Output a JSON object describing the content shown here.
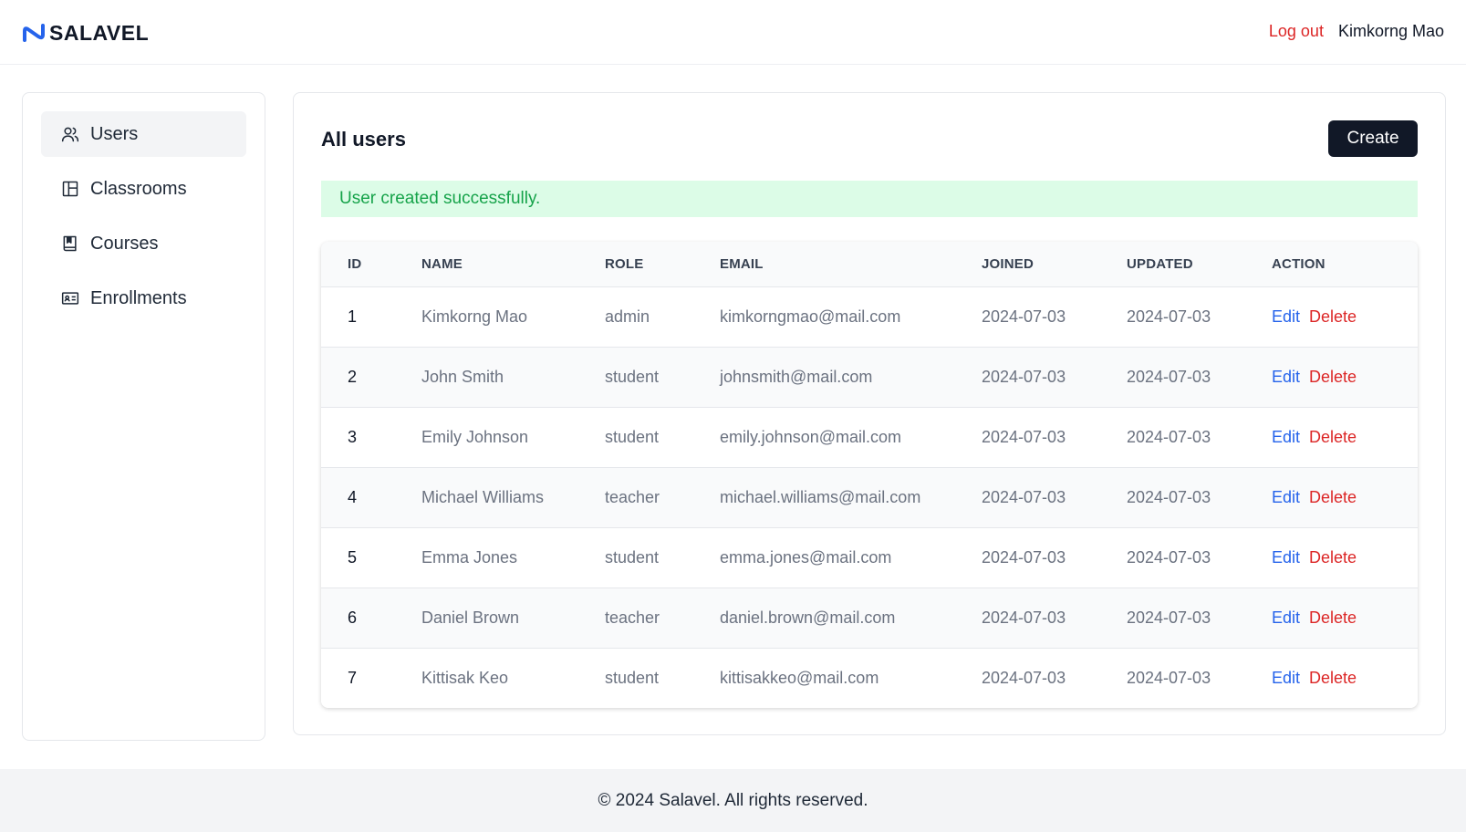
{
  "header": {
    "brand": "SALAVEL",
    "logout_label": "Log out",
    "user_name": "Kimkorng Mao"
  },
  "sidebar": {
    "items": [
      {
        "label": "Users",
        "icon": "users-icon",
        "active": true
      },
      {
        "label": "Classrooms",
        "icon": "layout-icon",
        "active": false
      },
      {
        "label": "Courses",
        "icon": "book-icon",
        "active": false
      },
      {
        "label": "Enrollments",
        "icon": "id-card-icon",
        "active": false
      }
    ]
  },
  "main": {
    "title": "All users",
    "create_label": "Create",
    "alert": "User created successfully."
  },
  "table": {
    "headers": [
      "ID",
      "NAME",
      "ROLE",
      "EMAIL",
      "JOINED",
      "UPDATED",
      "ACTION"
    ],
    "edit_label": "Edit",
    "delete_label": "Delete",
    "rows": [
      {
        "id": "1",
        "name": "Kimkorng Mao",
        "role": "admin",
        "email": "kimkorngmao@mail.com",
        "joined": "2024-07-03",
        "updated": "2024-07-03"
      },
      {
        "id": "2",
        "name": "John Smith",
        "role": "student",
        "email": "johnsmith@mail.com",
        "joined": "2024-07-03",
        "updated": "2024-07-03"
      },
      {
        "id": "3",
        "name": "Emily Johnson",
        "role": "student",
        "email": "emily.johnson@mail.com",
        "joined": "2024-07-03",
        "updated": "2024-07-03"
      },
      {
        "id": "4",
        "name": "Michael Williams",
        "role": "teacher",
        "email": "michael.williams@mail.com",
        "joined": "2024-07-03",
        "updated": "2024-07-03"
      },
      {
        "id": "5",
        "name": "Emma Jones",
        "role": "student",
        "email": "emma.jones@mail.com",
        "joined": "2024-07-03",
        "updated": "2024-07-03"
      },
      {
        "id": "6",
        "name": "Daniel Brown",
        "role": "teacher",
        "email": "daniel.brown@mail.com",
        "joined": "2024-07-03",
        "updated": "2024-07-03"
      },
      {
        "id": "7",
        "name": "Kittisak Keo",
        "role": "student",
        "email": "kittisakkeo@mail.com",
        "joined": "2024-07-03",
        "updated": "2024-07-03"
      }
    ]
  },
  "footer": {
    "text": "© 2024 Salavel. All rights reserved."
  },
  "colors": {
    "brand_blue": "#2563eb",
    "danger": "#dc2626",
    "success_bg": "#dcfce7",
    "success_text": "#16a34a",
    "primary_button": "#111827"
  }
}
